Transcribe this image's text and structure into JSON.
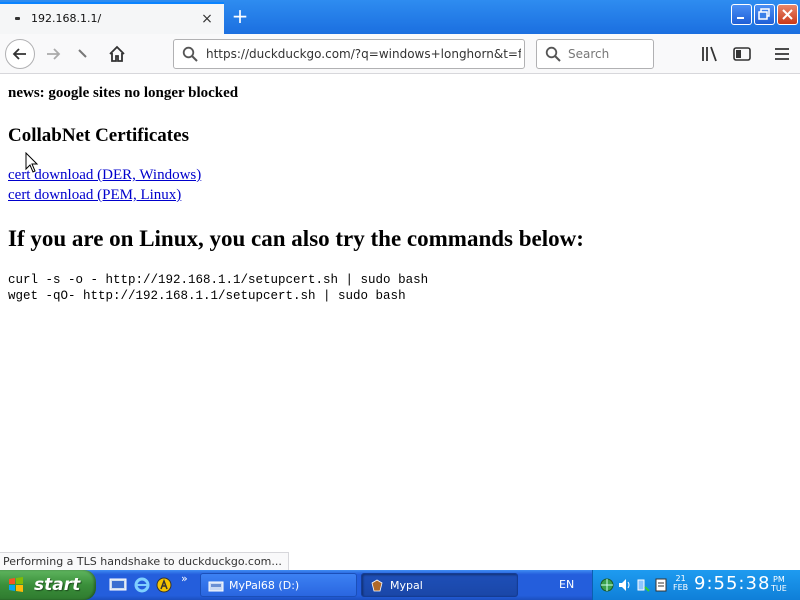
{
  "browser": {
    "tab_title": "192.168.1.1/",
    "tab_close": "×",
    "new_tab": "+",
    "url": "https://duckduckgo.com/?q=windows+longhorn&t=ffab",
    "search_placeholder": "Search",
    "status_text": "Performing a TLS handshake to duckduckgo.com...",
    "window_buttons": {
      "minimize": "_",
      "maximize": "□",
      "close": "×"
    }
  },
  "page": {
    "news": "news: google sites no longer blocked",
    "section_title": "CollabNet Certificates",
    "links": [
      "cert download (DER, Windows)",
      "cert download (PEM, Linux)"
    ],
    "linux_heading": "If you are on Linux, you can also try the commands below:",
    "commands": [
      "curl -s -o - http://192.168.1.1/setupcert.sh | sudo bash",
      "wget -qO- http://192.168.1.1/setupcert.sh | sudo bash"
    ]
  },
  "taskbar": {
    "start_label": "start",
    "overflow": "»",
    "tasks": [
      {
        "label": "MyPal68 (D:)"
      },
      {
        "label": "Mypal"
      }
    ],
    "language": "EN",
    "date_day": "21",
    "date_month": "FEB",
    "time": "9:55:38",
    "ampm": "PM",
    "weekday": "TUE"
  },
  "colors": {
    "link": "#0000cc",
    "taskbar_blue": "#245edc",
    "start_green": "#3a8f3a",
    "tab_accent": "#0a84ff"
  }
}
